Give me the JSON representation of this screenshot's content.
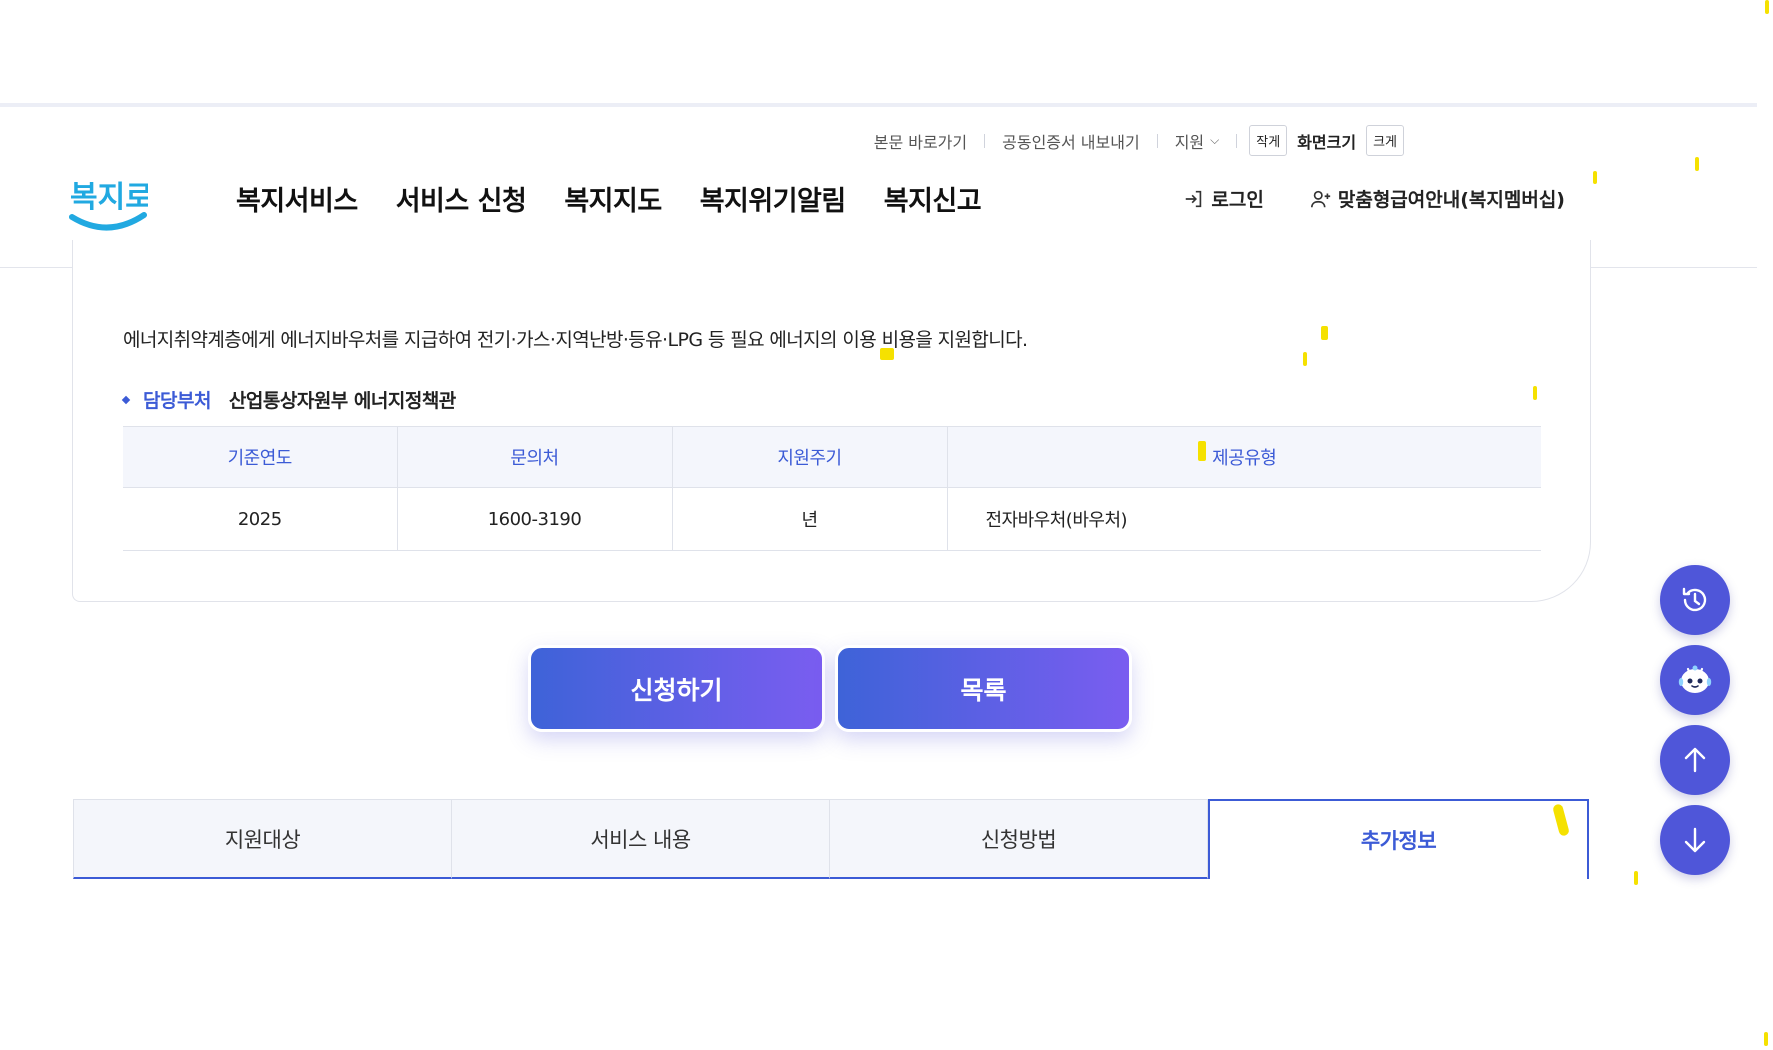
{
  "utility_bar": {
    "skip_to_content": "본문 바로가기",
    "export_certificate": "공동인증서 내보내기",
    "language": "지원",
    "size_small": "작게",
    "size_label": "화면크기",
    "size_large": "크게"
  },
  "logo": {
    "text": "복지로"
  },
  "gnb": {
    "items": [
      "복지서비스",
      "서비스 신청",
      "복지지도",
      "복지위기알림",
      "복지신고"
    ]
  },
  "account": {
    "login": "로그인",
    "membership": "맞춤형급여안내(복지멤버십)"
  },
  "content": {
    "description": "에너지취약계층에게 에너지바우처를 지급하여 전기·가스·지역난방·등유·LPG 등 필요 에너지의 이용 비용을 지원합니다.",
    "dept_label": "담당부처",
    "dept_value": "산업통상자원부 에너지정책관",
    "table": {
      "headers": [
        "기준연도",
        "문의처",
        "지원주기",
        "제공유형"
      ],
      "row": [
        "2025",
        "1600-3190",
        "년",
        "전자바우처(바우처)"
      ]
    }
  },
  "actions": {
    "apply": "신청하기",
    "list": "목록"
  },
  "tabs": {
    "items": [
      "지원대상",
      "서비스 내용",
      "신청방법",
      "추가정보"
    ],
    "active_index": 3
  },
  "floating": {
    "icons": [
      "history-icon",
      "chatbot-icon",
      "arrow-up-icon",
      "arrow-down-icon"
    ]
  },
  "colors": {
    "accent": "#3c5bd6",
    "button_gradient_start": "#3e63d8",
    "button_gradient_end": "#7a5df0",
    "float_button": "#4f56d9",
    "logo_blue": "#21a9e1"
  }
}
